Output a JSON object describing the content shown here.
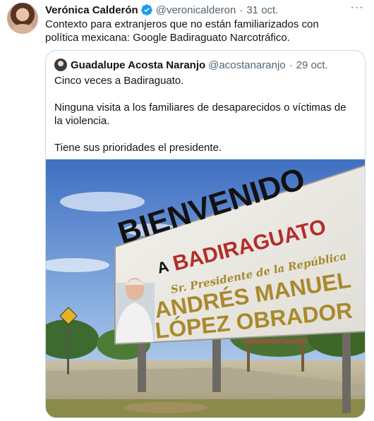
{
  "tweet": {
    "author_name": "Verónica Calderón",
    "author_handle": "@veronicalderon",
    "separator": "·",
    "date": "31 oct.",
    "text": "Contexto para extranjeros que no están familiarizados con política mexicana: Google Badiraguato Narcotráfico.",
    "more_label": "···"
  },
  "quote": {
    "author_name": "Guadalupe Acosta Naranjo",
    "author_handle": "@acostanaranjo",
    "separator": "·",
    "date": "29 oct.",
    "paragraphs": [
      "Cinco veces a Badiraguato.",
      "Ninguna visita a los familiares de desaparecidos o víctimas de la violencia.",
      "Tiene sus prioridades el presidente."
    ]
  },
  "photo": {
    "sign_line1": "BIENVENIDO",
    "sign_prefix": "A",
    "sign_town": "BADIRAGUATO",
    "sign_subtitle": "Sr. Presidente de la República",
    "sign_name1": "ANDRÉS MANUEL",
    "sign_name2": "LÓPEZ OBRADOR"
  },
  "colors": {
    "verified_blue": "#1d9bf0",
    "secondary_text": "#536471",
    "border": "#cfd9de",
    "sign_red": "#b42c2a",
    "sign_gold": "#a8892c"
  },
  "icons": {
    "verified": "verified-badge-icon",
    "more": "more-icon"
  }
}
